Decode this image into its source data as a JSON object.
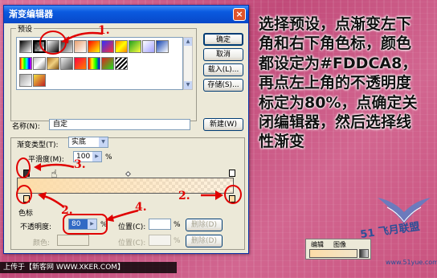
{
  "dialog": {
    "title": "渐变编辑器",
    "close": "×",
    "presets_label": "预设",
    "buttons": {
      "ok": "确定",
      "cancel": "取消",
      "load": "载入(L)...",
      "save": "存储(S)..."
    },
    "name_label": "名称(N):",
    "name_value": "自定",
    "new_button": "新建(W)",
    "gradient_type_label": "渐变类型(T):",
    "gradient_type_value": "实底",
    "smoothness_label": "平滑度(M):",
    "smoothness_value": "100",
    "smoothness_unit": "%",
    "color_stops_label": "色标",
    "opacity_label": "不透明度:",
    "opacity_value": "80",
    "opacity_unit": "%",
    "location_label": "位置(C):",
    "location_unit": "%",
    "delete_button": "删除(D)",
    "color_label": "颜色:",
    "location2_label": "位置(C):",
    "location2_unit": "%",
    "delete2_button": "删除(D)",
    "stop_color": "#FDDCA8",
    "stop_opacity_percent": 80
  },
  "annotations": [
    "1.",
    "2.",
    "3.",
    "4.",
    "2.",
    "3."
  ],
  "instruction_text": "选择预设，点渐变左下角和右下角色标，颜色都设定为#FDDCA8，再点左上角的不透明度标定为80%，点确定关闭编辑器，然后选择线性渐变",
  "mini_toolbar": {
    "edit": "编辑",
    "image": "图像"
  },
  "caption": "上传于【新客网 WWW.XKER.COM】",
  "watermark": {
    "brand": "51 飞月联盟",
    "url": "www.51yue.com"
  },
  "colors": {
    "annotation_red": "#e00000",
    "titlebar_blue": "#0a5ae0",
    "gradient_color": "#FDDCA8"
  }
}
